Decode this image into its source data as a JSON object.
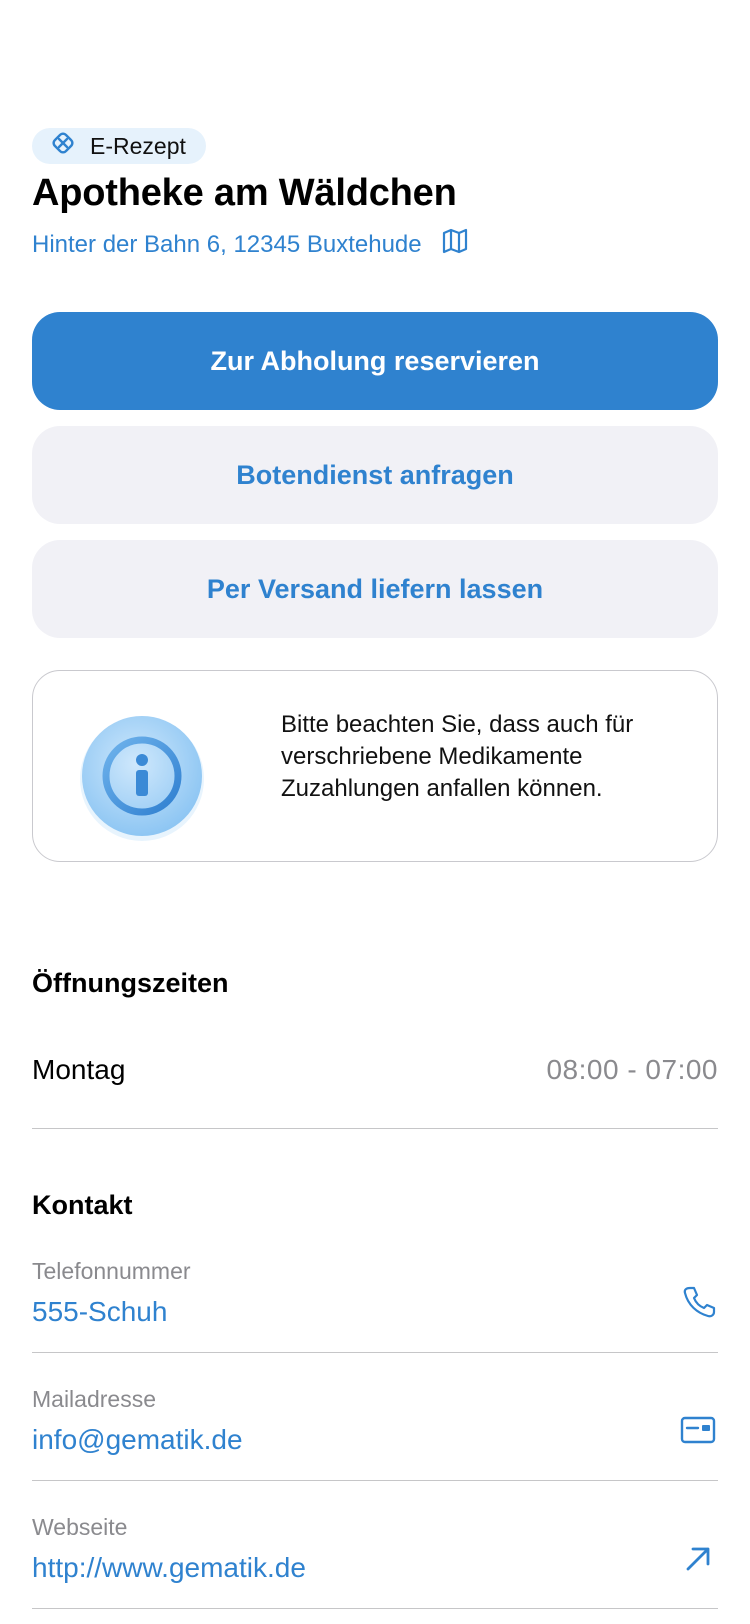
{
  "badge": {
    "label": "E-Rezept",
    "icon": "e-prescription-icon"
  },
  "pharmacy": {
    "name": "Apotheke am Wäldchen",
    "address": "Hinter der Bahn 6, 12345 Buxtehude"
  },
  "actions": {
    "reserve_label": "Zur Abholung reservieren",
    "courier_label": "Botendienst anfragen",
    "shipping_label": "Per Versand liefern lassen"
  },
  "notice": {
    "text": "Bitte beachten Sie, dass auch für verschriebene Medikamente Zuzahlungen anfallen können."
  },
  "opening_hours": {
    "title": "Öffnungszeiten",
    "rows": [
      {
        "day": "Montag",
        "time": "08:00 - 07:00"
      }
    ]
  },
  "contact": {
    "title": "Kontakt",
    "phone": {
      "label": "Telefonnummer",
      "value": "555-Schuh"
    },
    "mail": {
      "label": "Mailadresse",
      "value": "info@gematik.de"
    },
    "web": {
      "label": "Webseite",
      "value": "http://www.gematik.de"
    }
  },
  "colors": {
    "accent": "#2f82cf",
    "secondary_button_bg": "#f1f1f6",
    "badge_bg": "#e6f2fc",
    "muted_text": "#8a8a8e"
  }
}
